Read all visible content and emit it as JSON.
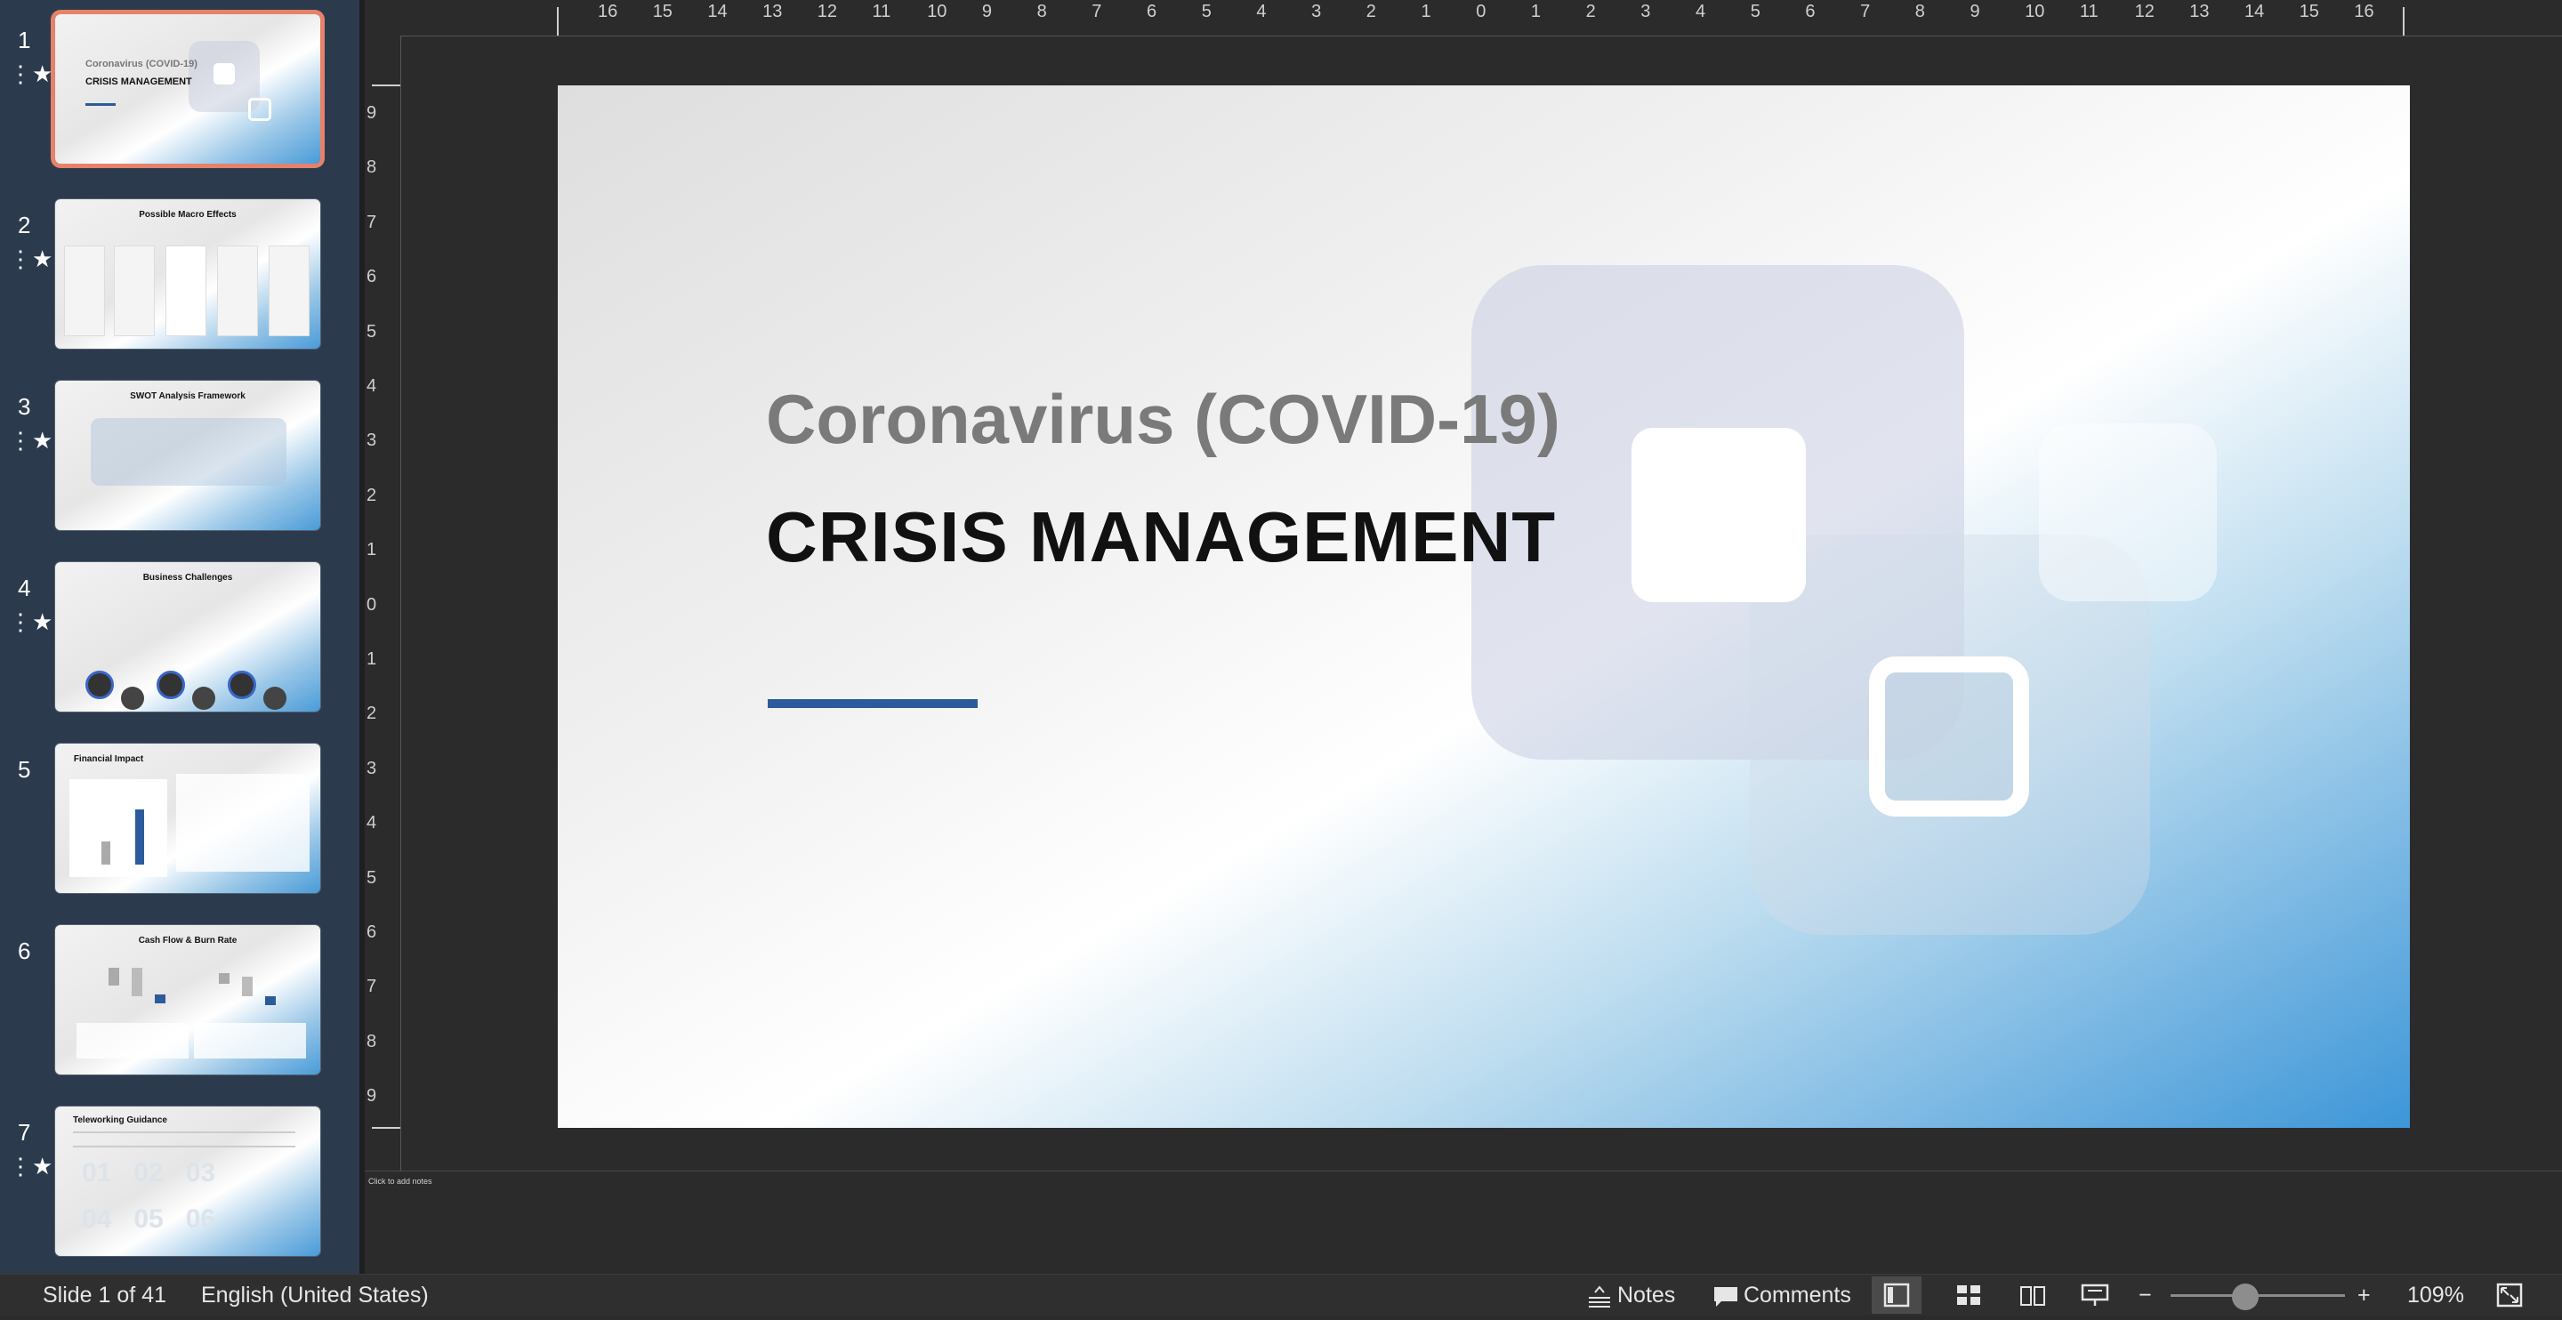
{
  "slide_panel": {
    "thumbnails": [
      {
        "number": "1",
        "title": "",
        "text_top": "Coronavirus (COVID-19)",
        "text_main": "CRISIS MANAGEMENT",
        "starred": true,
        "selected": true
      },
      {
        "number": "2",
        "title": "Possible Macro Effects",
        "starred": true,
        "selected": false
      },
      {
        "number": "3",
        "title": "SWOT Analysis Framework",
        "starred": true,
        "selected": false
      },
      {
        "number": "4",
        "title": "Business Challenges",
        "starred": true,
        "selected": false
      },
      {
        "number": "5",
        "title": "Financial Impact",
        "starred": false,
        "selected": false
      },
      {
        "number": "6",
        "title": "Cash Flow & Burn Rate",
        "starred": false,
        "selected": false
      },
      {
        "number": "7",
        "title": "Teleworking Guidance",
        "starred": true,
        "selected": false
      }
    ]
  },
  "ruler": {
    "horizontal": [
      "16",
      "15",
      "14",
      "13",
      "12",
      "11",
      "10",
      "9",
      "8",
      "7",
      "6",
      "5",
      "4",
      "3",
      "2",
      "1",
      "0",
      "1",
      "2",
      "3",
      "4",
      "5",
      "6",
      "7",
      "8",
      "9",
      "10",
      "11",
      "12",
      "13",
      "14",
      "15",
      "16"
    ],
    "vertical": [
      "9",
      "8",
      "7",
      "6",
      "5",
      "4",
      "3",
      "2",
      "1",
      "0",
      "1",
      "2",
      "3",
      "4",
      "5",
      "6",
      "7",
      "8",
      "9"
    ]
  },
  "slide": {
    "subtitle": "Coronavirus (COVID-19)",
    "title": "CRISIS MANAGEMENT",
    "accent_color": "#2b5b9b"
  },
  "notes": {
    "placeholder": "Click to add notes"
  },
  "status": {
    "slide_position": "Slide 1 of 41",
    "language": "English (United States)",
    "notes_label": "Notes",
    "comments_label": "Comments",
    "zoom_minus": "−",
    "zoom_plus": "+",
    "zoom_level": "109%",
    "zoom_fraction": 0.43
  },
  "icons": [
    "star-icon",
    "notes-icon",
    "comments-icon",
    "normal-view-icon",
    "slide-sorter-icon",
    "reading-view-icon",
    "slideshow-icon",
    "fit-to-window-icon"
  ]
}
